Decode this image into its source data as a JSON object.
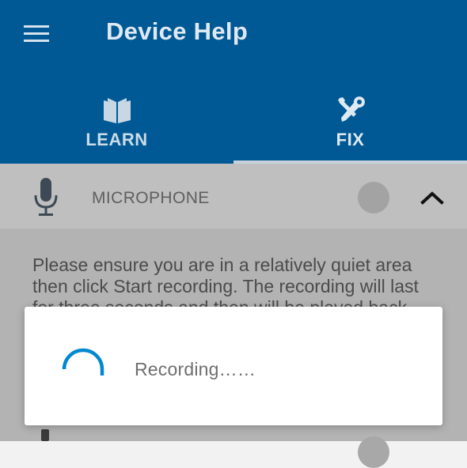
{
  "header": {
    "title": "Device Help",
    "menu_icon": "hamburger-menu-icon"
  },
  "tabs": [
    {
      "label": "LEARN",
      "icon": "book-icon",
      "selected": false
    },
    {
      "label": "FIX",
      "icon": "wrench-screwdriver-icon",
      "selected": true
    }
  ],
  "section": {
    "icon": "microphone-icon",
    "label": "MICROPHONE",
    "expanded": true,
    "collapse_icon": "chevron-up-icon"
  },
  "instructions": "Please ensure you are in a relatively quiet area then click Start recording. The recording will last for three seconds and then will be played back.",
  "dialog": {
    "message": "Recording……",
    "icon": "progress-spinner-icon"
  },
  "colors": {
    "app_bar": "#005995",
    "accent": "#0288d1",
    "scrim": "#b3b3b3"
  }
}
